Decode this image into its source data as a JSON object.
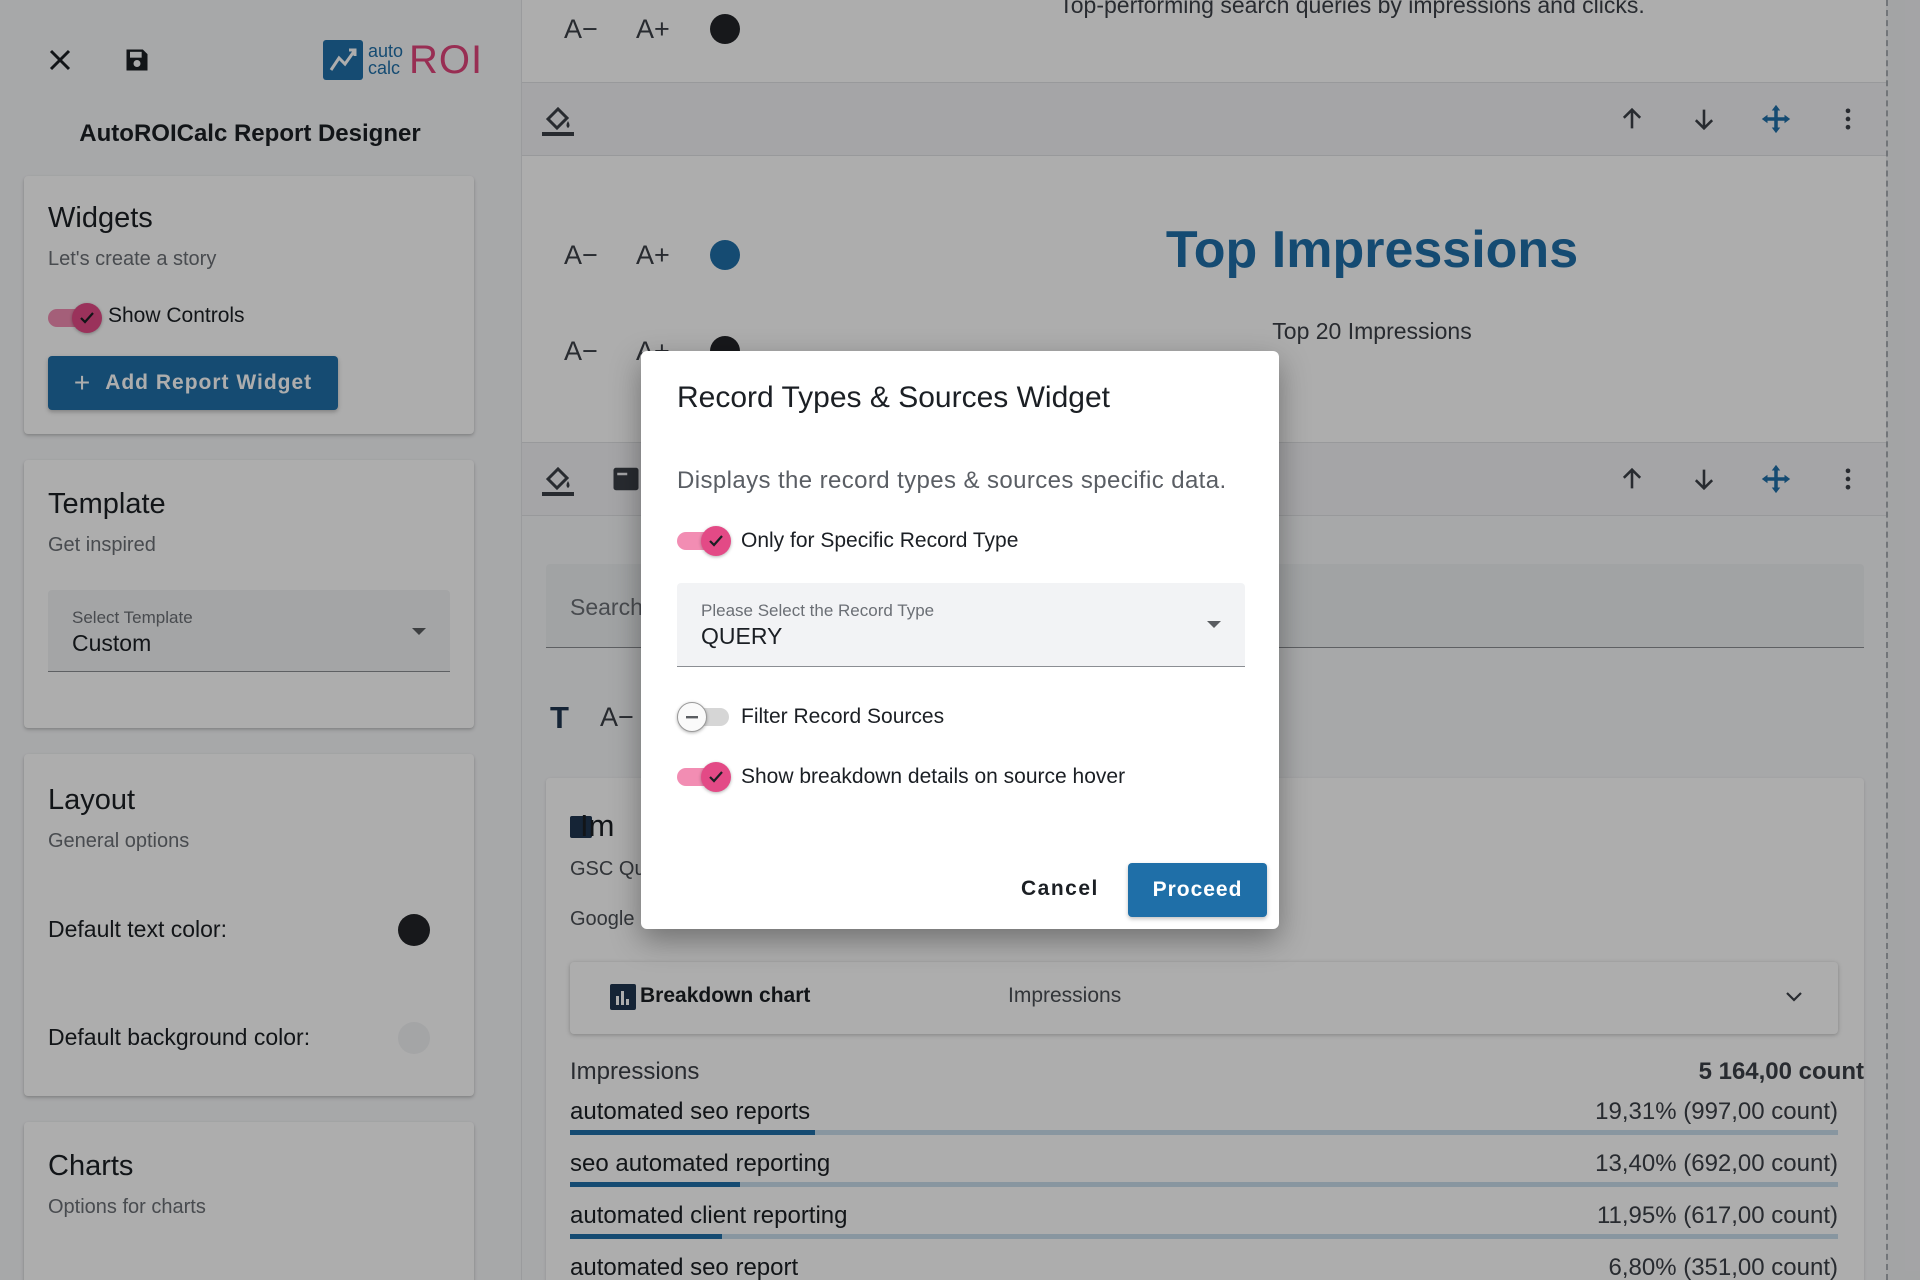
{
  "app": {
    "title": "AutoROICalc Report Designer",
    "logo": {
      "line1": "auto",
      "line2": "calc",
      "brand": "ROI"
    }
  },
  "sidebar": {
    "widgets": {
      "title": "Widgets",
      "subtitle": "Let's create a story",
      "show_controls_label": "Show Controls",
      "show_controls_on": true,
      "add_button_label": "Add Report Widget"
    },
    "template": {
      "title": "Template",
      "subtitle": "Get inspired",
      "select_label": "Select Template",
      "select_value": "Custom"
    },
    "layout": {
      "title": "Layout",
      "subtitle": "General options",
      "text_color_label": "Default text color:",
      "text_color": "#222428",
      "bg_color_label": "Default background color:",
      "bg_color": "#f2f3f5"
    },
    "charts": {
      "title": "Charts",
      "subtitle": "Options for charts"
    }
  },
  "canvas": {
    "top_caption": "Top-performing search queries by impressions and clicks.",
    "font_dec": "A−",
    "font_inc": "A+",
    "headline": "Top Impressions",
    "headline_color": "#1f6fa8",
    "subheadline": "Top 20 Impressions",
    "search_placeholder": "Search",
    "text_tool_glyph": "T",
    "widget": {
      "title": "Im",
      "sub1": "GSC Qu",
      "sub2": "Google",
      "accordion_title": "Breakdown chart",
      "accordion_metric": "Impressions",
      "breakdown_label": "Impressions",
      "breakdown_total": "5 164,00 count",
      "rows": [
        {
          "label": "automated seo reports",
          "value": "19,31% (997,00 count)",
          "fraction": 0.1931
        },
        {
          "label": "seo automated reporting",
          "value": "13,40% (692,00 count)",
          "fraction": 0.134
        },
        {
          "label": "automated client reporting",
          "value": "11,95% (617,00 count)",
          "fraction": 0.1195
        },
        {
          "label": "automated seo report",
          "value": "6,80% (351,00 count)",
          "fraction": 0.068
        }
      ]
    }
  },
  "dialog": {
    "title": "Record Types & Sources Widget",
    "description": "Displays the record types & sources specific data.",
    "options": [
      {
        "label": "Only for Specific Record Type",
        "on": true
      },
      {
        "label": "Filter Record Sources",
        "on": false
      },
      {
        "label": "Show breakdown details on source hover",
        "on": true
      }
    ],
    "record_type_label": "Please Select the Record Type",
    "record_type_value": "QUERY",
    "cancel_label": "Cancel",
    "proceed_label": "Proceed"
  },
  "colors": {
    "primary": "#1f6fa8",
    "accent": "#e34a86"
  }
}
